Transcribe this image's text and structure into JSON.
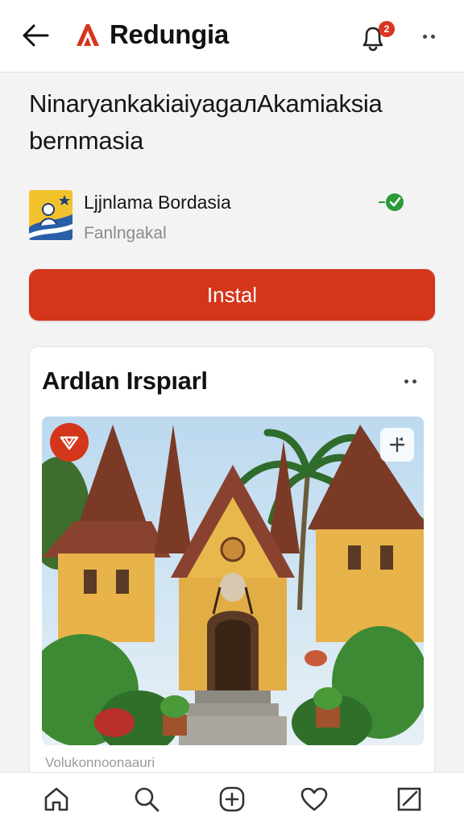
{
  "header": {
    "brand_title": "Redungia",
    "notification_count": "2",
    "accent_color": "#d4361b"
  },
  "headline": {
    "line1": "NinaryankakiaiyagaлAkamiaksia",
    "line2": "bernmasia"
  },
  "app": {
    "name": "Ljjnlama Bordasia",
    "subtitle": "Fanlngakal",
    "verified_color": "#2a9a3a"
  },
  "install": {
    "label": "Instal"
  },
  "card": {
    "title": "Ardlan Irspıarl",
    "caption": "Volukonnoonaauri"
  },
  "nav": {
    "items": [
      "home-icon",
      "search-icon",
      "create-icon",
      "heart-icon",
      "compose-icon"
    ]
  }
}
